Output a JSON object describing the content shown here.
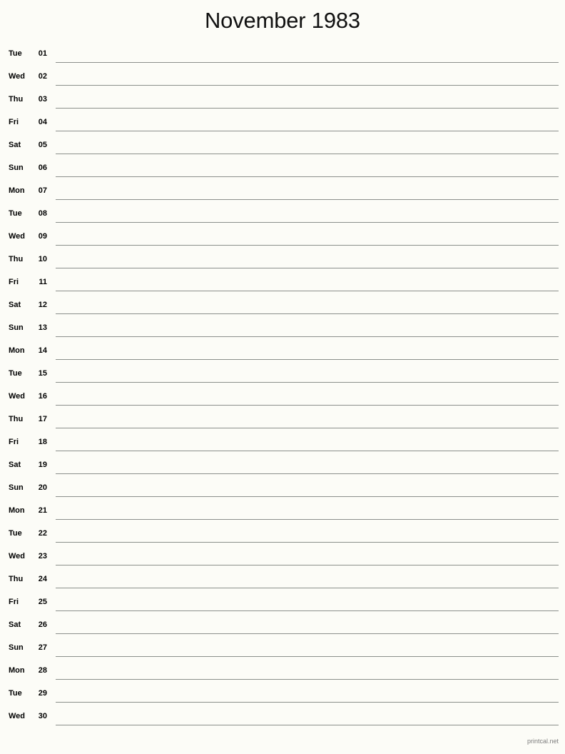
{
  "document": {
    "type": "printable-monthly-calendar",
    "title": "November 1983",
    "month_name": "November",
    "year": "1983"
  },
  "colors": {
    "page_background": "#fcfcf7",
    "text": "#000000",
    "title_text": "#111111",
    "rule_line": "#8b8f8b",
    "footer_text": "#7d7d7d"
  },
  "days": [
    {
      "dow": "Tue",
      "num": "01"
    },
    {
      "dow": "Wed",
      "num": "02"
    },
    {
      "dow": "Thu",
      "num": "03"
    },
    {
      "dow": "Fri",
      "num": "04"
    },
    {
      "dow": "Sat",
      "num": "05"
    },
    {
      "dow": "Sun",
      "num": "06"
    },
    {
      "dow": "Mon",
      "num": "07"
    },
    {
      "dow": "Tue",
      "num": "08"
    },
    {
      "dow": "Wed",
      "num": "09"
    },
    {
      "dow": "Thu",
      "num": "10"
    },
    {
      "dow": "Fri",
      "num": "11"
    },
    {
      "dow": "Sat",
      "num": "12"
    },
    {
      "dow": "Sun",
      "num": "13"
    },
    {
      "dow": "Mon",
      "num": "14"
    },
    {
      "dow": "Tue",
      "num": "15"
    },
    {
      "dow": "Wed",
      "num": "16"
    },
    {
      "dow": "Thu",
      "num": "17"
    },
    {
      "dow": "Fri",
      "num": "18"
    },
    {
      "dow": "Sat",
      "num": "19"
    },
    {
      "dow": "Sun",
      "num": "20"
    },
    {
      "dow": "Mon",
      "num": "21"
    },
    {
      "dow": "Tue",
      "num": "22"
    },
    {
      "dow": "Wed",
      "num": "23"
    },
    {
      "dow": "Thu",
      "num": "24"
    },
    {
      "dow": "Fri",
      "num": "25"
    },
    {
      "dow": "Sat",
      "num": "26"
    },
    {
      "dow": "Sun",
      "num": "27"
    },
    {
      "dow": "Mon",
      "num": "28"
    },
    {
      "dow": "Tue",
      "num": "29"
    },
    {
      "dow": "Wed",
      "num": "30"
    }
  ],
  "footer": {
    "credit": "printcal.net"
  }
}
